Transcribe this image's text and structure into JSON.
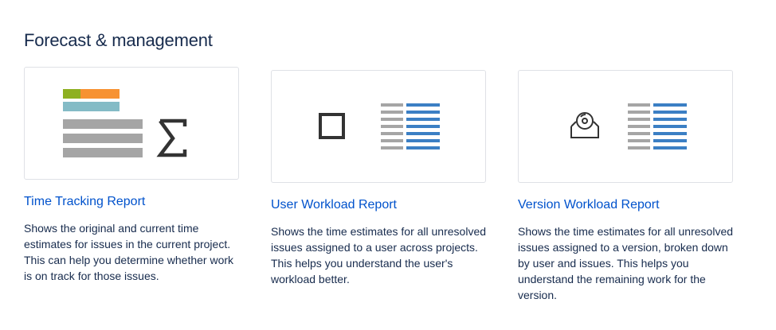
{
  "section": {
    "title": "Forecast & management"
  },
  "colors": {
    "link": "#0052cc",
    "text": "#172b4d",
    "border": "#dfe1e6",
    "bar_gray": "#a5a5a5",
    "bar_blue": "#3b7fc4",
    "bar_green": "#8eb021",
    "bar_orange": "#f79232",
    "bar_teal": "#84bbc6",
    "icon_dark": "#333333"
  },
  "reports": [
    {
      "title": "Time Tracking Report",
      "description": "Shows the original and current time estimates for issues in the current project. This can help you determine whether work is on track for those issues.",
      "icon": "time-tracking-illustration"
    },
    {
      "title": "User Workload Report",
      "description": "Shows the time estimates for all unresolved issues assigned to a user across projects. This helps you understand the user's workload better.",
      "icon": "user-workload-illustration"
    },
    {
      "title": "Version Workload Report",
      "description": "Shows the time estimates for all unresolved issues assigned to a version, broken down by user and issues. This helps you understand the remaining work for the version.",
      "icon": "version-workload-illustration"
    }
  ]
}
